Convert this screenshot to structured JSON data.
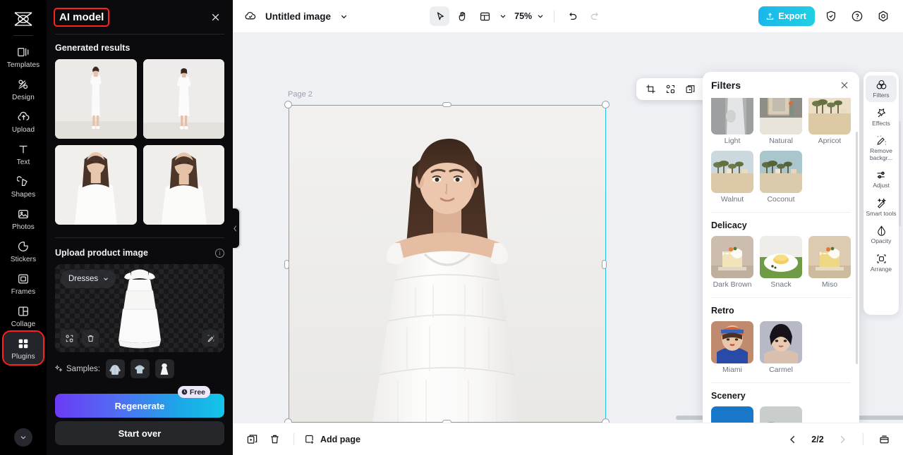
{
  "rail": {
    "logo_icon": "capcut-logo-icon",
    "items": [
      {
        "label": "Templates",
        "icon": "templates-icon"
      },
      {
        "label": "Design",
        "icon": "design-icon"
      },
      {
        "label": "Upload",
        "icon": "upload-cloud-icon"
      },
      {
        "label": "Text",
        "icon": "text-icon"
      },
      {
        "label": "Shapes",
        "icon": "shapes-icon"
      },
      {
        "label": "Photos",
        "icon": "photos-icon"
      },
      {
        "label": "Stickers",
        "icon": "stickers-icon"
      },
      {
        "label": "Frames",
        "icon": "frames-icon"
      },
      {
        "label": "Collage",
        "icon": "collage-icon"
      },
      {
        "label": "Plugins",
        "icon": "plugins-icon"
      }
    ],
    "expand_icon": "chevron-down-icon"
  },
  "panel": {
    "title": "AI model",
    "close_icon": "close-icon",
    "generated_results_label": "Generated results",
    "results_count": 4,
    "upload_section_label": "Upload product image",
    "info_icon": "info-icon",
    "category_value": "Dresses",
    "category_chevron": "chevron-down-icon",
    "box_buttons": [
      {
        "name": "replace-image-button",
        "icon": "replace-icon"
      },
      {
        "name": "delete-image-button",
        "icon": "trash-icon"
      },
      {
        "name": "edit-image-button",
        "icon": "magic-edit-icon"
      }
    ],
    "samples_label": "Samples:",
    "samples_icon": "sparkle-icon",
    "samples": [
      "sample-jacket",
      "sample-shirt",
      "sample-dress"
    ],
    "regenerate_label": "Regenerate",
    "free_badge": "Free",
    "free_badge_icon": "clock-icon",
    "start_over_label": "Start over",
    "collapse_icon": "chevron-left-icon"
  },
  "topbar": {
    "cloud_icon": "cloud-saved-icon",
    "doc_title": "Untitled image",
    "title_chevron": "chevron-down-icon",
    "tools": [
      {
        "name": "select-tool",
        "icon": "cursor-icon",
        "selected": true
      },
      {
        "name": "hand-tool",
        "icon": "hand-icon",
        "selected": false
      },
      {
        "name": "layout-tool",
        "icon": "layout-icon",
        "selected": false
      }
    ],
    "layout_chevron": "chevron-down-icon",
    "zoom_level": "75%",
    "zoom_chevron": "chevron-down-icon",
    "undo_icon": "undo-icon",
    "redo_icon": "redo-icon",
    "export_label": "Export",
    "export_icon": "export-upload-icon",
    "export_color": "#1ec2e6",
    "shield_icon": "shield-icon",
    "help_icon": "help-circle-icon",
    "settings_icon": "settings-gear-icon"
  },
  "canvas": {
    "page_label": "Page 2",
    "selection_color": "#23c4e8",
    "rotate_icon": "rotate-icon",
    "float_toolbar": [
      {
        "name": "crop-button",
        "icon": "crop-icon"
      },
      {
        "name": "replace-button",
        "icon": "replace-icon"
      },
      {
        "name": "duplicate-button",
        "icon": "duplicate-icon"
      },
      {
        "name": "more-options-button",
        "icon": "more-horizontal-icon"
      }
    ]
  },
  "bottombar": {
    "duplicate_page_icon": "duplicate-page-icon",
    "delete_page_icon": "trash-icon",
    "add_page_label": "Add page",
    "add_page_icon": "add-page-icon",
    "prev_icon": "chevron-left-icon",
    "page_indicator": "2/2",
    "next_icon": "chevron-right-icon",
    "pages_panel_icon": "pages-panel-icon"
  },
  "filters": {
    "title": "Filters",
    "close_icon": "close-icon",
    "groups": [
      {
        "name": "",
        "items": [
          {
            "label": "Light",
            "c1": "#9d9fa0",
            "c2": "#cfd2d0"
          },
          {
            "label": "Natural",
            "c1": "#c9c0b2",
            "c2": "#8f8e86"
          },
          {
            "label": "Apricot",
            "c1": "#e9dcc4",
            "c2": "#d6c49e"
          }
        ]
      },
      {
        "name": "",
        "items": [
          {
            "label": "Walnut",
            "c1": "#c8d6db",
            "c2": "#d8c4a2"
          },
          {
            "label": "Coconut",
            "c1": "#a9c6cd",
            "c2": "#d6c9ad"
          }
        ]
      },
      {
        "name": "Delicacy",
        "items": [
          {
            "label": "Dark Brown",
            "c1": "#cdbdae",
            "c2": "#e7d9b6"
          },
          {
            "label": "Snack",
            "c1": "#eceae7",
            "c2": "#6f9b46"
          },
          {
            "label": "Miso",
            "c1": "#d9c8ae",
            "c2": "#efd885"
          }
        ]
      },
      {
        "name": "Retro",
        "items": [
          {
            "label": "Miami",
            "c1": "#c28c72",
            "c2": "#2a4aa8"
          },
          {
            "label": "Carmel",
            "c1": "#b7b9c6",
            "c2": "#d9bfae"
          }
        ]
      },
      {
        "name": "Scenery",
        "items": [
          {
            "label": "",
            "c1": "#1877c9",
            "c2": "#e6b9c0"
          },
          {
            "label": "",
            "c1": "#c9cdcb",
            "c2": "#6d7d5c"
          }
        ]
      }
    ]
  },
  "tools_rail": {
    "items": [
      {
        "label": "Filters",
        "icon": "filters-icon",
        "active": true
      },
      {
        "label": "Effects",
        "icon": "effects-icon",
        "active": false
      },
      {
        "label": "Remove backgr...",
        "icon": "remove-background-icon",
        "active": false
      },
      {
        "label": "Adjust",
        "icon": "adjust-sliders-icon",
        "active": false
      },
      {
        "label": "Smart tools",
        "icon": "smart-tools-icon",
        "active": false
      },
      {
        "label": "Opacity",
        "icon": "opacity-drop-icon",
        "active": false
      },
      {
        "label": "Arrange",
        "icon": "arrange-icon",
        "active": false
      }
    ]
  }
}
